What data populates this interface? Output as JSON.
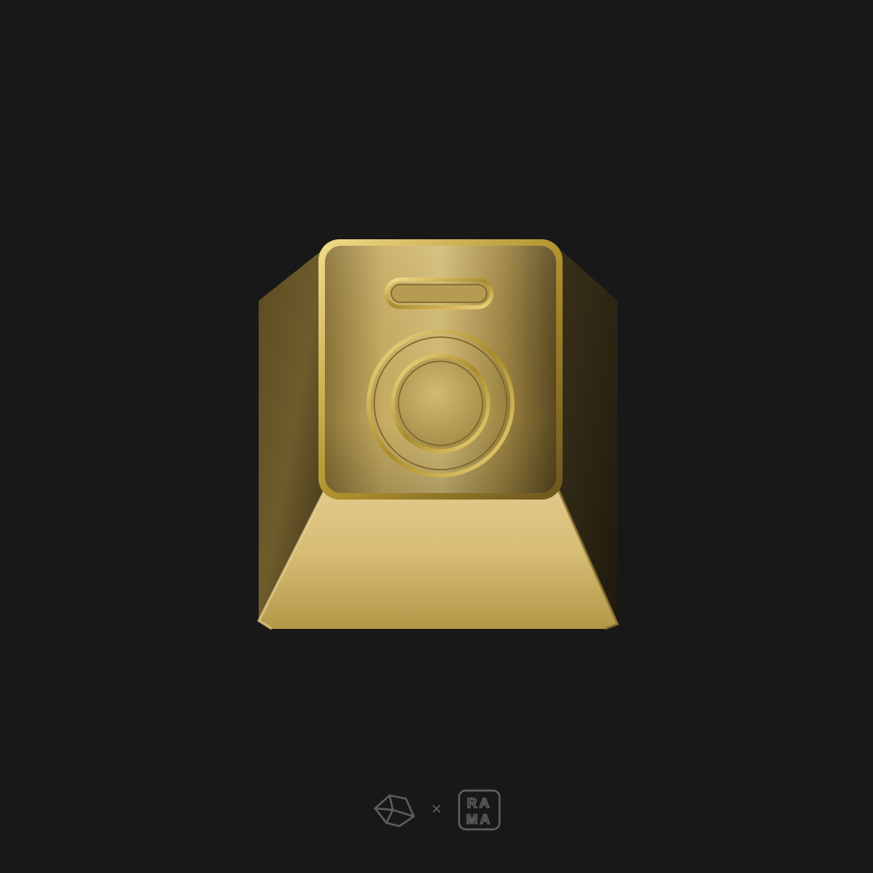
{
  "scene": {
    "background_color": "#181818",
    "subject": "keycap-washing-machine-icon",
    "subject_color": "#c9ae5a"
  },
  "footer": {
    "left_logo_icon": "geometric-stone-logo-icon",
    "separator": "×",
    "right_logo": {
      "icon": "rama-logo-icon",
      "line1": "RA",
      "line2": "MA"
    },
    "logo_color": "#5e5e5e"
  }
}
